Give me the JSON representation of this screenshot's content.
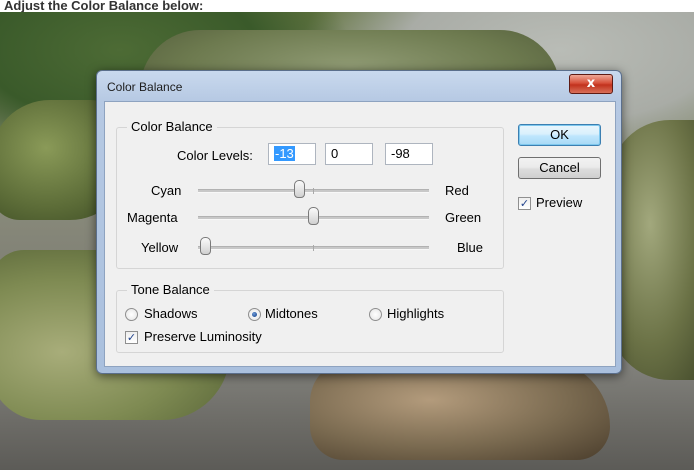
{
  "dialog": {
    "title": "Color Balance",
    "close_glyph": "x",
    "color_balance_group": {
      "legend": "Color Balance",
      "levels_label": "Color Levels:",
      "levels": [
        "-13",
        "0",
        "-98"
      ],
      "sliders": [
        {
          "left": "Cyan",
          "right": "Red",
          "value": -13,
          "min": -100,
          "max": 100
        },
        {
          "left": "Magenta",
          "right": "Green",
          "value": 0,
          "min": -100,
          "max": 100
        },
        {
          "left": "Yellow",
          "right": "Blue",
          "value": -98,
          "min": -100,
          "max": 100
        }
      ]
    },
    "tone_balance_group": {
      "legend": "Tone Balance",
      "options": [
        "Shadows",
        "Midtones",
        "Highlights"
      ],
      "selected": "Midtones",
      "preserve_luminosity_label": "Preserve Luminosity",
      "preserve_luminosity": true
    },
    "ok_label": "OK",
    "cancel_label": "Cancel",
    "preview_label": "Preview",
    "preview": true
  },
  "caption": "Adjust the Color Balance below:",
  "colors": {
    "close_button": "#c1321d",
    "selection": "#3399ff",
    "default_button_border": "#3c7fb1"
  }
}
